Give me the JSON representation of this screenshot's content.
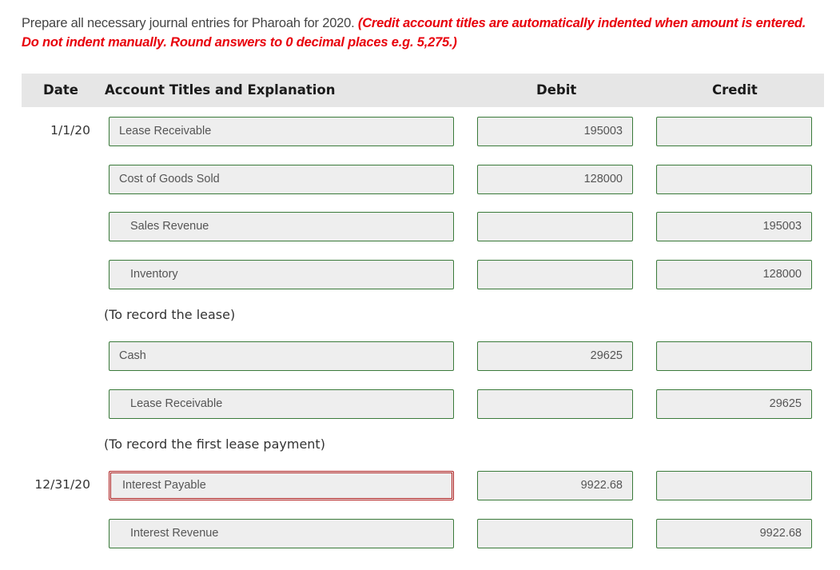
{
  "instructions": {
    "text": "Prepare all necessary journal entries for Pharoah for 2020.",
    "note_line1": "(Credit account titles are automatically indented when amount is entered.",
    "note_line2": "Do not indent manually. Round answers to 0 decimal places e.g. 5,275.)"
  },
  "table": {
    "headers": {
      "date": "Date",
      "account": "Account Titles and Explanation",
      "debit": "Debit",
      "credit": "Credit"
    },
    "rows": [
      {
        "date": "1/1/20",
        "account": "Lease Receivable",
        "debit": "195003",
        "credit": ""
      },
      {
        "date": "",
        "account": "Cost of Goods Sold",
        "debit": "128000",
        "credit": ""
      },
      {
        "date": "",
        "account": "Sales Revenue",
        "debit": "",
        "credit": "195003"
      },
      {
        "date": "",
        "account": "Inventory",
        "debit": "",
        "credit": "128000"
      },
      {
        "date": "",
        "account": "Cash",
        "debit": "29625",
        "credit": ""
      },
      {
        "date": "",
        "account": "Lease Receivable",
        "debit": "",
        "credit": "29625"
      },
      {
        "date": "12/31/20",
        "account": "Interest Payable",
        "debit": "9922.68",
        "credit": ""
      },
      {
        "date": "",
        "account": "Interest Revenue",
        "debit": "",
        "credit": "9922.68"
      }
    ],
    "explanations": [
      "(To record the lease)",
      "(To record the first lease payment)"
    ]
  }
}
